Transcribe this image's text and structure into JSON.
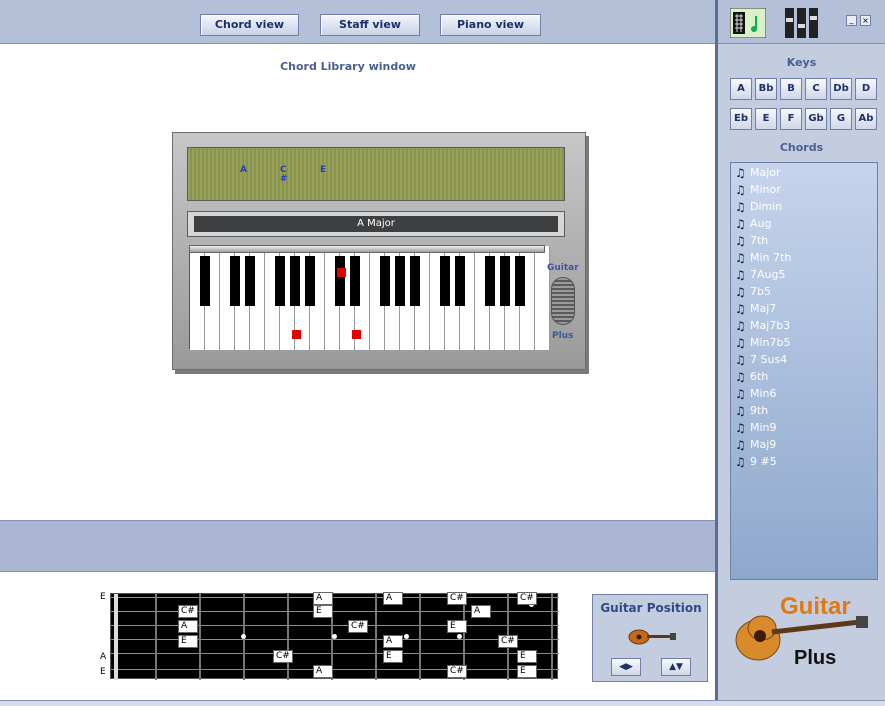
{
  "toolbar": {
    "chord_view": "Chord view",
    "staff_view": "Staff view",
    "piano_view": "Piano view"
  },
  "window": {
    "title": "Chord Library window"
  },
  "lcd": {
    "n1": "A",
    "n2": "C",
    "n2b": "#",
    "n3": "E"
  },
  "chord_name": "A Major",
  "keyboard": {
    "brand_top": "Guitar",
    "brand_bottom": "Plus"
  },
  "sidebar": {
    "keys_heading": "Keys",
    "keys_row1": [
      "A",
      "Bb",
      "B",
      "C",
      "Db",
      "D"
    ],
    "keys_row2": [
      "Eb",
      "E",
      "F",
      "Gb",
      "G",
      "Ab"
    ],
    "chords_heading": "Chords",
    "chords": [
      "Major",
      "Minor",
      "Dimin",
      "Aug",
      "7th",
      "Min 7th",
      "7Aug5",
      "7b5",
      "Maj7",
      "Maj7b3",
      "Min7b5",
      "7 Sus4",
      "6th",
      "Min6",
      "9th",
      "Min9",
      "Maj9",
      "9 #5"
    ]
  },
  "fretboard": {
    "string_labels": [
      "E",
      "A",
      "E"
    ],
    "notes": [
      "A",
      "E",
      "C#",
      "C#",
      "A",
      "A",
      "E",
      "E",
      "C#",
      "A",
      "C#",
      "C#",
      "E",
      "C#",
      "E",
      "A",
      "E",
      "A",
      "E",
      "C#",
      "A",
      "E"
    ]
  },
  "guitar_position": {
    "title": "Guitar Position",
    "left_right": "◀▶",
    "up_down": "▲▼"
  },
  "logo": {
    "line1": "Guitar",
    "line2": "Plus"
  },
  "colors": {
    "accent": "#4a5f8f",
    "panel": "#c4cde0",
    "marker": "#e00000"
  }
}
